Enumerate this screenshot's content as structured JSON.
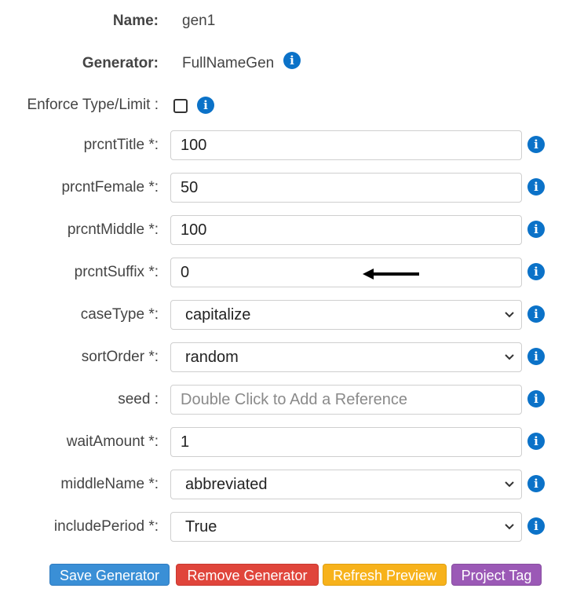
{
  "header": {
    "name_label": "Name:",
    "name_value": "gen1",
    "generator_label": "Generator:",
    "generator_value": "FullNameGen",
    "enforce_label": "Enforce Type/Limit :"
  },
  "fields": [
    {
      "label": "prcntTitle *:",
      "type": "text",
      "value": "100"
    },
    {
      "label": "prcntFemale *:",
      "type": "text",
      "value": "50"
    },
    {
      "label": "prcntMiddle *:",
      "type": "text",
      "value": "100"
    },
    {
      "label": "prcntSuffix *:",
      "type": "text",
      "value": "0"
    },
    {
      "label": "caseType *:",
      "type": "select",
      "value": "capitalize"
    },
    {
      "label": "sortOrder *:",
      "type": "select",
      "value": "random"
    },
    {
      "label": "seed :",
      "type": "text",
      "value": "",
      "placeholder": "Double Click to Add a Reference"
    },
    {
      "label": "waitAmount *:",
      "type": "text",
      "value": "1"
    },
    {
      "label": "middleName *:",
      "type": "select",
      "value": "abbreviated"
    },
    {
      "label": "includePeriod *:",
      "type": "select",
      "value": "True"
    }
  ],
  "buttons": {
    "save": "Save Generator",
    "remove": "Remove Generator",
    "refresh": "Refresh Preview",
    "project_tag": "Project Tag"
  },
  "icons": {
    "info": "info-icon",
    "chevron": "chevron-down-icon",
    "arrow": "left-arrow-icon"
  },
  "colors": {
    "info": "#0b72c8",
    "save": "#3a8fd6",
    "remove": "#e0453b",
    "refresh": "#f7b21b",
    "project_tag": "#9b59b6"
  }
}
